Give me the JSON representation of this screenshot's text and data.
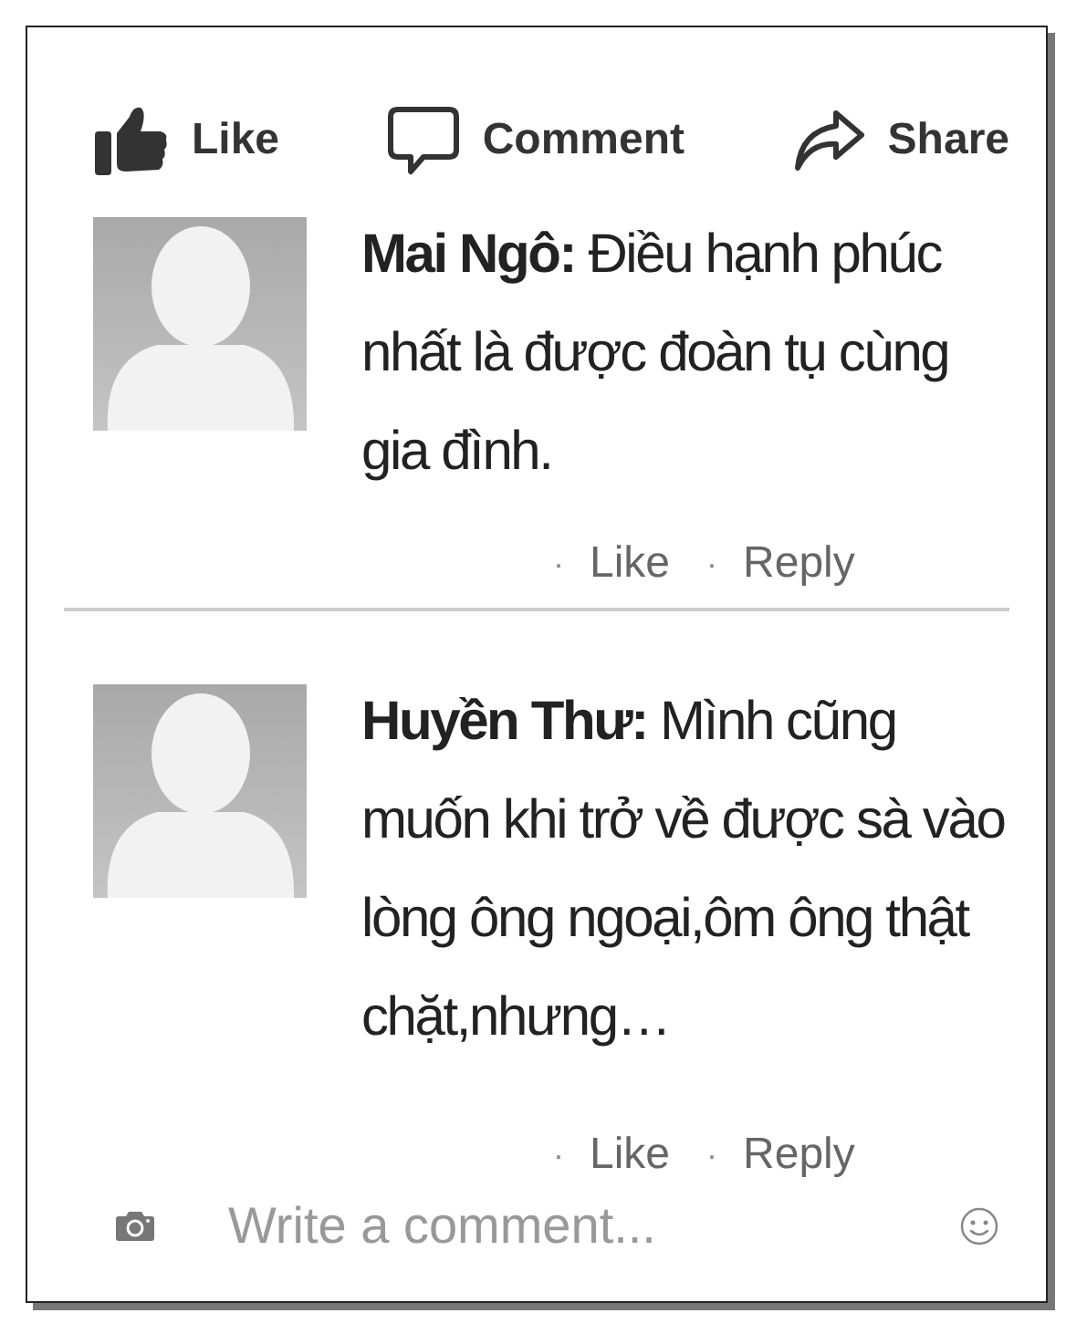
{
  "actions": [
    {
      "kind": "like",
      "label": "Like"
    },
    {
      "kind": "comment",
      "label": "Comment"
    },
    {
      "kind": "share",
      "label": "Share"
    }
  ],
  "comments": [
    {
      "author": "Mai Ngô:",
      "text": "Điều hạnh phúc nhất là được đoàn tụ cùng gia đình.",
      "links": [
        {
          "dot": "·",
          "label": "Like"
        },
        {
          "dot": "·",
          "label": "Reply"
        }
      ]
    },
    {
      "author": "Huyền Thư:",
      "text": "Mình cũng muốn khi trở về được sà vào lòng ông ngoại,ôm ông thật chặt,nhưng…",
      "links": [
        {
          "dot": "·",
          "label": "Like"
        },
        {
          "dot": "·",
          "label": "Reply"
        }
      ]
    }
  ],
  "composer": {
    "placeholder": "Write a comment..."
  }
}
